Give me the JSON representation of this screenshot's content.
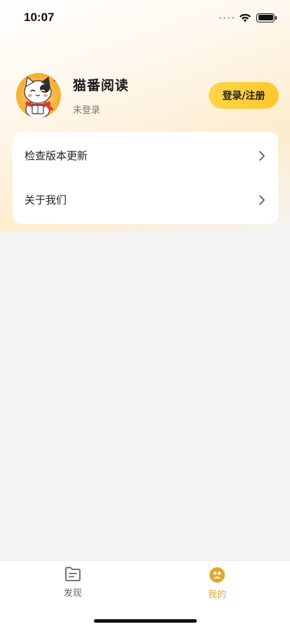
{
  "status_bar": {
    "time": "10:07",
    "icons": [
      "signal-icon",
      "wifi-icon",
      "battery-icon"
    ]
  },
  "profile": {
    "app_name": "猫番阅读",
    "login_state": "未登录",
    "login_button": "登录/注册",
    "avatar_icon": "cat-mascot-avatar"
  },
  "menu": {
    "items": [
      {
        "label": "检查版本更新",
        "icon": "chevron-right-icon"
      },
      {
        "label": "关于我们",
        "icon": "chevron-right-icon"
      }
    ]
  },
  "tabs": [
    {
      "label": "发现",
      "icon": "folder-icon",
      "active": false
    },
    {
      "label": "我的",
      "icon": "profile-icon",
      "active": true
    }
  ],
  "colors": {
    "accent": "#e6a52a",
    "button": "#ffc72c",
    "background": "#f4f4f4",
    "card": "#ffffff"
  }
}
